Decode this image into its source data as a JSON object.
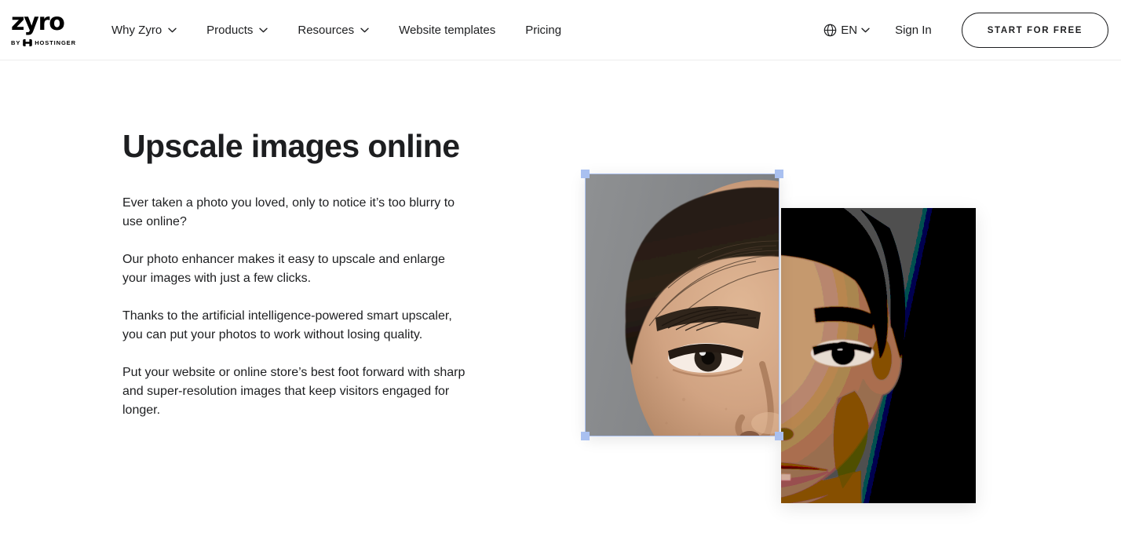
{
  "header": {
    "logo": {
      "wordmark": "zyro",
      "by_label": "BY",
      "parent_brand": "HOSTINGER"
    },
    "nav": [
      {
        "label": "Why Zyro",
        "has_dropdown": true
      },
      {
        "label": "Products",
        "has_dropdown": true
      },
      {
        "label": "Resources",
        "has_dropdown": true
      },
      {
        "label": "Website templates",
        "has_dropdown": false
      },
      {
        "label": "Pricing",
        "has_dropdown": false
      }
    ],
    "language": {
      "code": "EN",
      "icon": "globe-icon"
    },
    "sign_in": "Sign In",
    "cta": "START FOR FREE"
  },
  "hero": {
    "title": "Upscale images online",
    "paragraphs": [
      "Ever taken a photo you loved, only to notice it’s too blurry to use online?",
      "Our photo enhancer makes it easy to upscale and enlarge your images with just a few clicks.",
      "Thanks to the artificial intelligence-powered smart upscaler, you can put your photos to work without losing quality.",
      "Put your website or online store’s best foot forward with sharp and super-resolution images that keep visitors engaged for longer."
    ]
  },
  "visual": {
    "back_image_alt": "pixelated low-resolution portrait of a young man on grey background",
    "front_image_alt": "sharp upscaled portrait of a young man on grey background",
    "selection": {
      "handles": [
        "top-left",
        "top-right",
        "bottom-left",
        "bottom-right"
      ],
      "border_color": "#aec3f0",
      "handle_color": "#a9c0f0"
    }
  },
  "colors": {
    "text": "#1d1e20",
    "background": "#ffffff",
    "header_border": "#ededed",
    "selection_accent": "#a9c0f0"
  }
}
